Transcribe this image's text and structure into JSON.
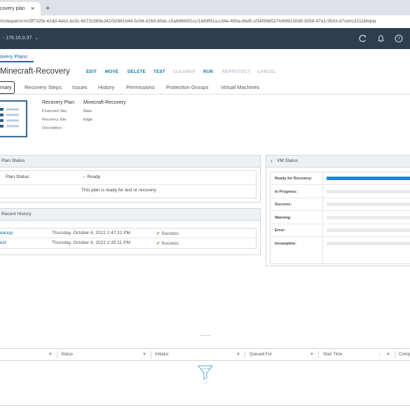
{
  "browser": {
    "tab_title": "covery plan",
    "tab_close": "×",
    "new_tab": "+",
    "url": "#/sitepair/srm/3ff732fe-42dd-4eb2-bc5c-6572c585e342/92881644-5c94-4168-85dc-c5a68665f1cc/1849f91a-c34e-480a-8bd5-cf34f89d5374/699130d9-3056-47a1-9543-d7ce0c3211bb/pla"
  },
  "header": {
    "host": "- 176.16.0.37",
    "host_chevron": "⌄"
  },
  "breadcrumb": "overy Plans",
  "page_title": "Minecraft-Recovery",
  "actions": [
    "EDIT",
    "MOVE",
    "DELETE",
    "TEST",
    "CLEANUP",
    "RUN",
    "REPROTECT",
    "CANCEL"
  ],
  "tabs": [
    "mary",
    "Recovery Steps",
    "Issues",
    "History",
    "Permissions",
    "Protection Groups",
    "Virtual Machines"
  ],
  "summary": {
    "plan_label": "Recovery Plan:",
    "plan_value": "Minecraft-Recovery",
    "protected_label": "Protected Site:",
    "protected_value": "Main",
    "recovery_label": "Recovery Site:",
    "recovery_value": "Edge",
    "description_label": "Description:",
    "description_value": ""
  },
  "plan_status": {
    "title": "Plan Status",
    "label": "Plan Status:",
    "value": "Ready",
    "arrow": "→",
    "message": "This plan is ready for test or recovery"
  },
  "recent_history": {
    "title": "Recent History",
    "rows": [
      {
        "name": "eanup",
        "date": "Thursday, October 6, 2022 2:47:22 PM",
        "status": "Success"
      },
      {
        "name": "est",
        "date": "Thursday, October 6, 2022 2:35:21 PM",
        "status": "Success"
      }
    ]
  },
  "vm_status": {
    "title": "VM Status",
    "chevron": "›",
    "rows": [
      {
        "label": "Ready for Recovery:",
        "fraction": 1.0
      },
      {
        "label": "In Progress:",
        "fraction": 0
      },
      {
        "label": "Success:",
        "fraction": 0
      },
      {
        "label": "Warning:",
        "fraction": 0
      },
      {
        "label": "Error:",
        "fraction": 0
      },
      {
        "label": "Incomplete:",
        "fraction": 0
      }
    ]
  },
  "tasks": {
    "columns": [
      "Status",
      "Initiator",
      "Queued For",
      "Start Time",
      "Comp"
    ],
    "sort_icon": "↓",
    "filter_glyph": "▼"
  },
  "colors": {
    "header_bg": "#2d3e4f",
    "accent": "#0072a3",
    "bar_fill": "#0a8fd1",
    "success": "#3c8500"
  }
}
